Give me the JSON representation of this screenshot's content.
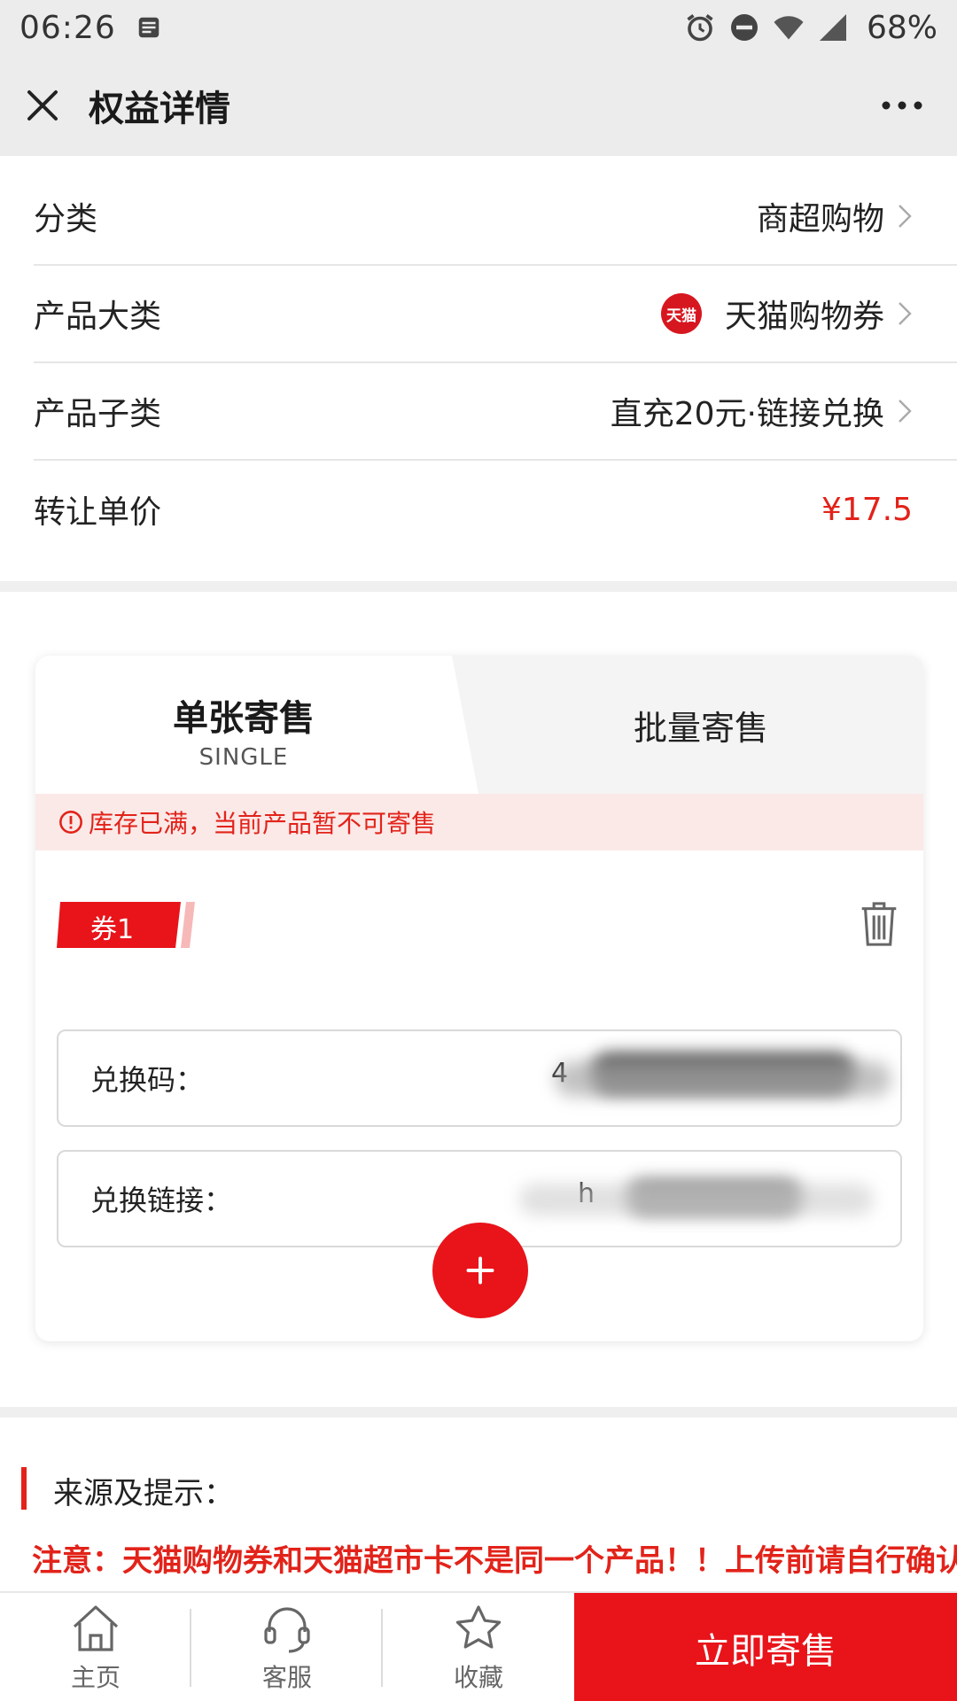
{
  "status_bar": {
    "time": "06:26",
    "battery": "68%"
  },
  "nav": {
    "title": "权益详情"
  },
  "info": {
    "category_label": "分类",
    "category_value": "商超购物",
    "product_label": "产品大类",
    "product_value": "天猫购物券",
    "product_logo_text": "天猫",
    "subproduct_label": "产品子类",
    "subproduct_value": "直充20元·链接兑换",
    "price_label": "转让单价",
    "price_value": "¥17.5"
  },
  "sell": {
    "tab_single_title": "单张寄售",
    "tab_single_sub": "SINGLE",
    "tab_batch": "批量寄售",
    "warning": "库存已满，当前产品暂不可寄售",
    "coupon_label": "券1",
    "code_label": "兑换码：",
    "code_value_partial": "4",
    "link_label": "兑换链接：",
    "link_value_partial": "h"
  },
  "notes": {
    "heading": "来源及提示：",
    "warning": "注意：天猫购物券和天猫超市卡不是同一个产品！！上传前请自行确认"
  },
  "bottom": {
    "home": "主页",
    "service": "客服",
    "favorite": "收藏",
    "consign_now": "立即寄售"
  },
  "colors": {
    "accent": "#e8141a",
    "warning_bg": "#fbe9e8"
  }
}
